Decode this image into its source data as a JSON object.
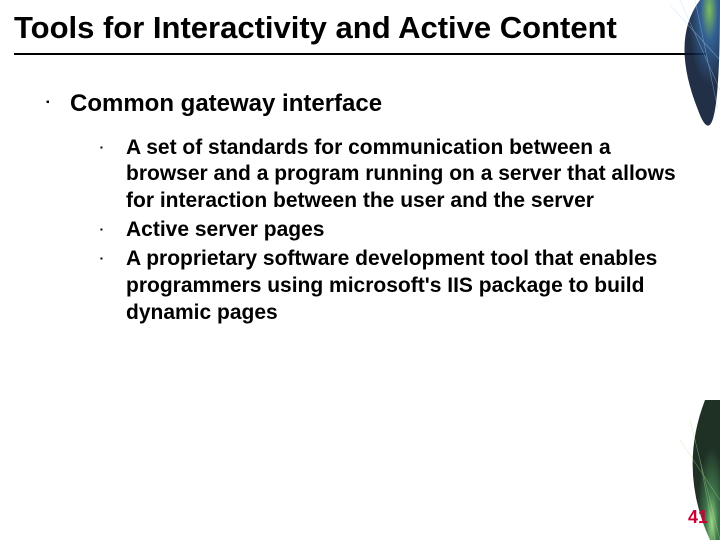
{
  "title": "Tools for Interactivity and Active Content",
  "body": {
    "level1": [
      {
        "text": "Common gateway interface",
        "children": [
          "A set of standards for communication between a browser and a program running on a server that allows for interaction between the user and the server",
          "Active server pages",
          "A proprietary software development tool that enables programmers using microsoft's IIS package to build dynamic pages"
        ]
      }
    ]
  },
  "page_number": "41"
}
